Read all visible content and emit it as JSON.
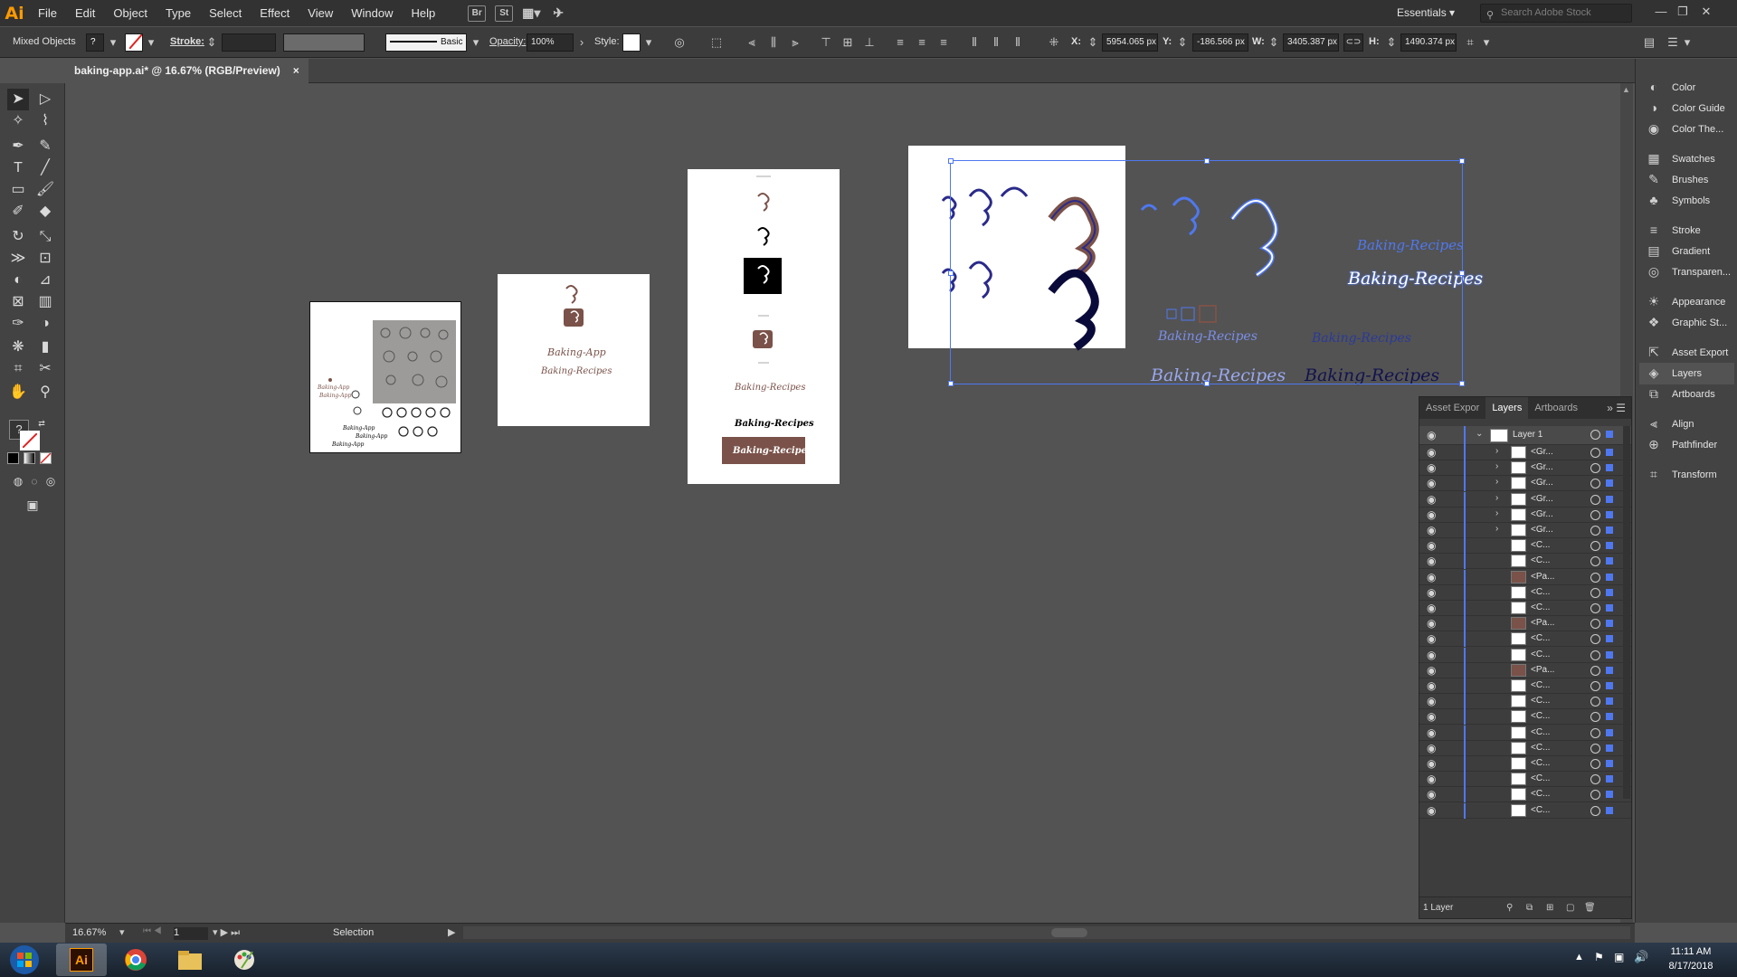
{
  "app": {
    "logo": "Ai"
  },
  "menu": [
    "File",
    "Edit",
    "Object",
    "Type",
    "Select",
    "Effect",
    "View",
    "Window",
    "Help"
  ],
  "menubar_icons": [
    "Br",
    "St"
  ],
  "workspace": "Essentials",
  "search_placeholder": "Search Adobe Stock",
  "control": {
    "selection_type": "Mixed Objects",
    "stroke_label": "Stroke:",
    "brush_label": "Basic",
    "opacity_label": "Opacity:",
    "opacity_value": "100%",
    "style_label": "Style:",
    "x_label": "X:",
    "x_value": "5954.065 px",
    "y_label": "Y:",
    "y_value": "-186.566 px",
    "w_label": "W:",
    "w_value": "3405.387 px",
    "h_label": "H:",
    "h_value": "1490.374 px"
  },
  "document_tab": {
    "title": "baking-app.ai* @ 16.67% (RGB/Preview)",
    "close": "×"
  },
  "artboard_texts": {
    "baking_app": "Baking-App",
    "baking_recipes": "Baking-Recipes"
  },
  "right_dock": [
    {
      "label": "Color",
      "icon": "color-icon"
    },
    {
      "label": "Color Guide",
      "icon": "color-guide-icon"
    },
    {
      "label": "Color The...",
      "icon": "color-themes-icon"
    },
    {
      "label": "Swatches",
      "icon": "swatches-icon"
    },
    {
      "label": "Brushes",
      "icon": "brushes-icon"
    },
    {
      "label": "Symbols",
      "icon": "symbols-icon"
    },
    {
      "label": "Stroke",
      "icon": "stroke-icon"
    },
    {
      "label": "Gradient",
      "icon": "gradient-icon"
    },
    {
      "label": "Transparen...",
      "icon": "transparency-icon"
    },
    {
      "label": "Appearance",
      "icon": "appearance-icon"
    },
    {
      "label": "Graphic St...",
      "icon": "graphic-styles-icon"
    },
    {
      "label": "Asset Export",
      "icon": "asset-export-icon"
    },
    {
      "label": "Layers",
      "icon": "layers-icon"
    },
    {
      "label": "Artboards",
      "icon": "artboards-icon"
    },
    {
      "label": "Align",
      "icon": "align-icon"
    },
    {
      "label": "Pathfinder",
      "icon": "pathfinder-icon"
    },
    {
      "label": "Transform",
      "icon": "transform-icon"
    }
  ],
  "layers_panel": {
    "tabs": [
      "Asset Expor",
      "Layers",
      "Artboards"
    ],
    "layer_name": "Layer 1",
    "rows": [
      {
        "name": "<Gr...",
        "thumb": "#ffffff",
        "expand": true
      },
      {
        "name": "<Gr...",
        "thumb": "#ffffff",
        "expand": true
      },
      {
        "name": "<Gr...",
        "thumb": "#ffffff",
        "expand": true
      },
      {
        "name": "<Gr...",
        "thumb": "#ffffff",
        "expand": true
      },
      {
        "name": "<Gr...",
        "thumb": "#ffffff",
        "expand": true
      },
      {
        "name": "<Gr...",
        "thumb": "#ffffff",
        "expand": true
      },
      {
        "name": "<C...",
        "thumb": "#ffffff",
        "expand": false
      },
      {
        "name": "<C...",
        "thumb": "#ffffff",
        "expand": false
      },
      {
        "name": "<Pa...",
        "thumb": "#7a5249",
        "expand": false
      },
      {
        "name": "<C...",
        "thumb": "#ffffff",
        "expand": false
      },
      {
        "name": "<C...",
        "thumb": "#ffffff",
        "expand": false
      },
      {
        "name": "<Pa...",
        "thumb": "#7a5249",
        "expand": false
      },
      {
        "name": "<C...",
        "thumb": "#ffffff",
        "expand": false
      },
      {
        "name": "<C...",
        "thumb": "#ffffff",
        "expand": false
      },
      {
        "name": "<Pa...",
        "thumb": "#7a5249",
        "expand": false
      },
      {
        "name": "<C...",
        "thumb": "#ffffff",
        "expand": false
      },
      {
        "name": "<C...",
        "thumb": "#ffffff",
        "expand": false
      },
      {
        "name": "<C...",
        "thumb": "#ffffff",
        "expand": false
      },
      {
        "name": "<C...",
        "thumb": "#ffffff",
        "expand": false
      },
      {
        "name": "<C...",
        "thumb": "#ffffff",
        "expand": false
      },
      {
        "name": "<C...",
        "thumb": "#ffffff",
        "expand": false
      },
      {
        "name": "<C...",
        "thumb": "#ffffff",
        "expand": false
      },
      {
        "name": "<C...",
        "thumb": "#ffffff",
        "expand": false
      },
      {
        "name": "<C...",
        "thumb": "#ffffff",
        "expand": false
      }
    ],
    "footer": "1 Layer"
  },
  "status": {
    "zoom": "16.67%",
    "page": "1",
    "tool": "Selection"
  },
  "taskbar": {
    "time": "11:11 AM",
    "date": "8/17/2018"
  },
  "colors": {
    "brand_brown": "#7a5249",
    "selection_blue": "#4f78f0",
    "ai_orange": "#ff9a00"
  }
}
